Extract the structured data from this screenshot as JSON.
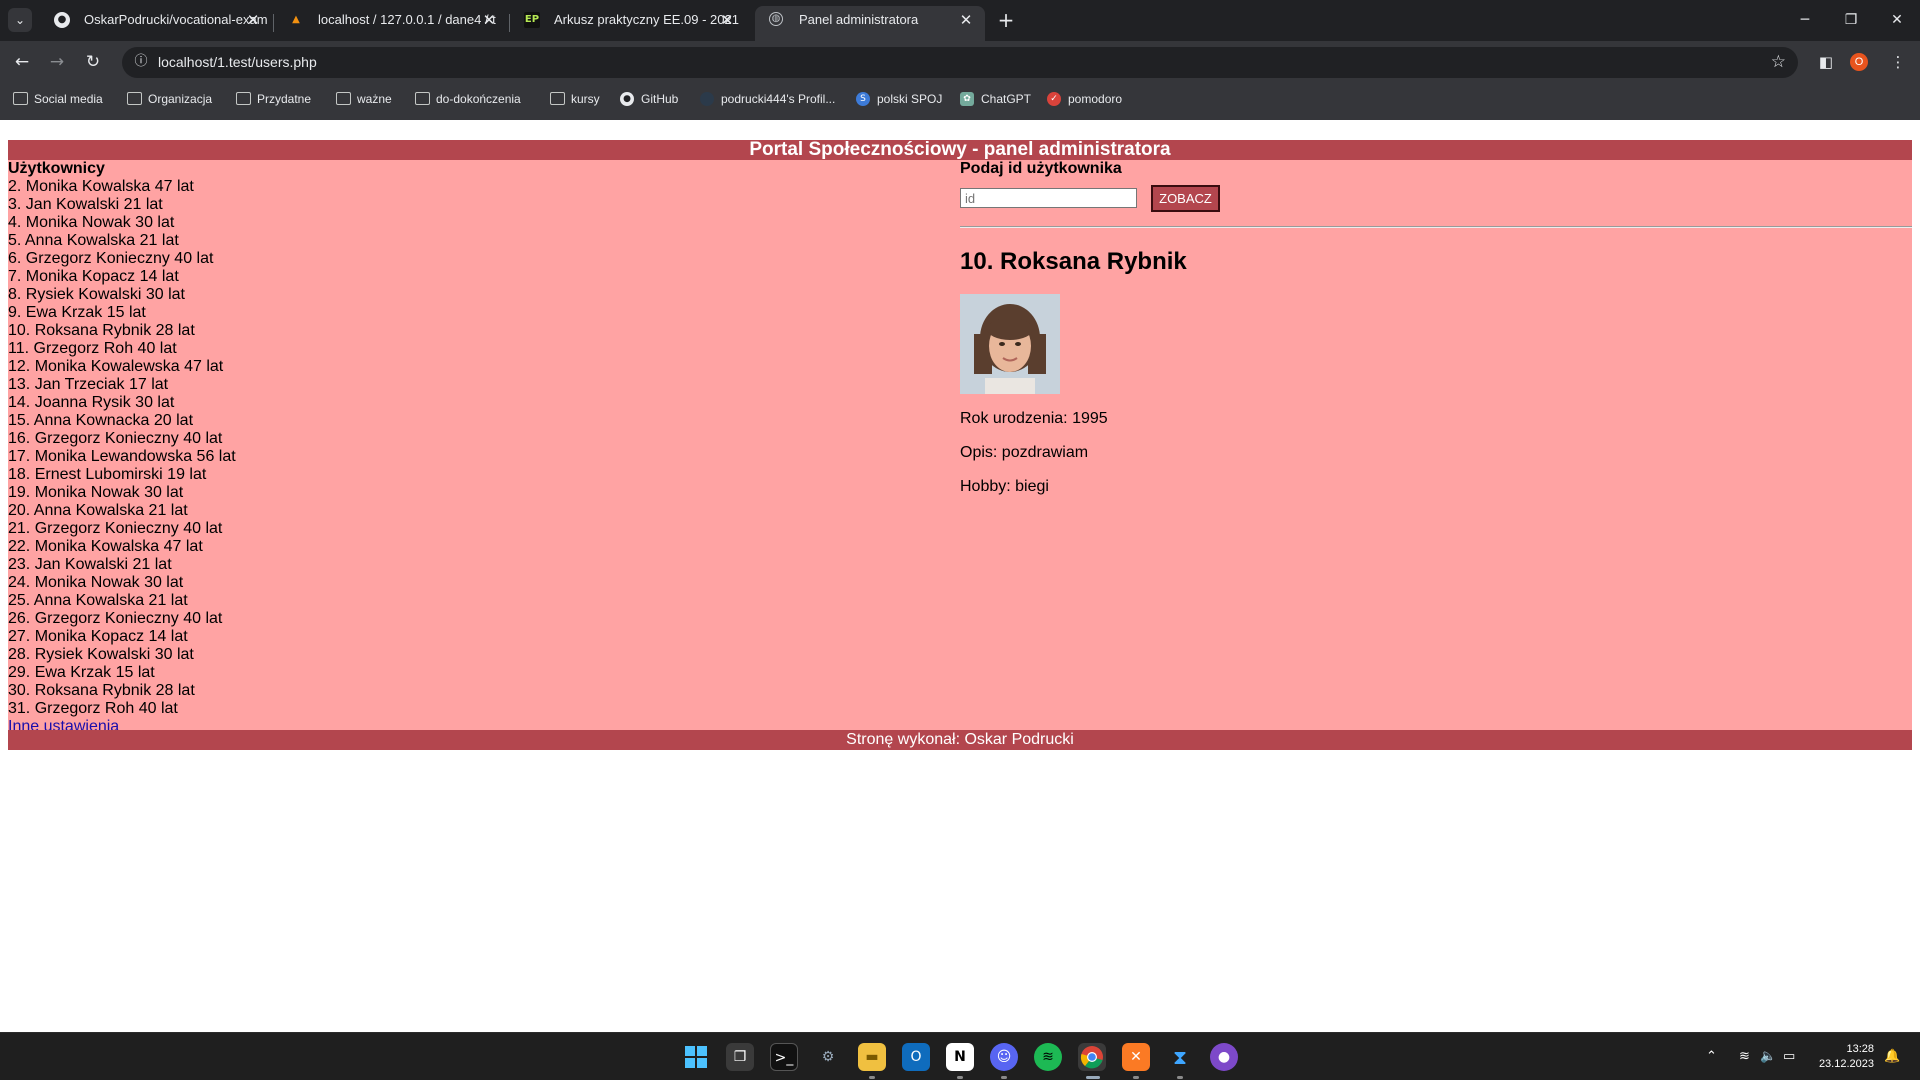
{
  "browser": {
    "tabs": [
      {
        "title": "OskarPodrucki/vocational-exam",
        "favicon": "github-icon",
        "active": false
      },
      {
        "title": "localhost / 127.0.0.1 / dane4 / t",
        "favicon": "phpmyadmin-icon",
        "active": false
      },
      {
        "title": "Arkusz praktyczny EE.09 - 2021",
        "favicon": "ep-icon",
        "active": false
      },
      {
        "title": "Panel administratora",
        "favicon": "globe-icon",
        "active": true
      }
    ],
    "url": "localhost/1.test/users.php",
    "profile_badge": "O",
    "bookmarks": [
      {
        "label": "Social media",
        "icon": "folder-icon"
      },
      {
        "label": "Organizacja",
        "icon": "folder-icon"
      },
      {
        "label": "Przydatne",
        "icon": "folder-icon"
      },
      {
        "label": "ważne",
        "icon": "folder-icon"
      },
      {
        "label": "do-dokończenia",
        "icon": "folder-icon"
      },
      {
        "label": "kursy",
        "icon": "folder-icon"
      },
      {
        "label": "GitHub",
        "icon": "github-icon"
      },
      {
        "label": "podrucki444's Profil...",
        "icon": "profile-icon"
      },
      {
        "label": "polski SPOJ",
        "icon": "spoj-icon"
      },
      {
        "label": "ChatGPT",
        "icon": "chatgpt-icon"
      },
      {
        "label": "pomodoro",
        "icon": "pomodoro-icon"
      }
    ]
  },
  "page": {
    "banner": "Portal Społecznościowy - panel administratora",
    "users_heading": "Użytkownicy",
    "users": [
      "2. Monika Kowalska 47 lat",
      "3. Jan Kowalski 21 lat",
      "4. Monika Nowak 30 lat",
      "5. Anna Kowalska 21 lat",
      "6. Grzegorz Konieczny 40 lat",
      "7. Monika Kopacz 14 lat",
      "8. Rysiek Kowalski 30 lat",
      "9. Ewa Krzak 15 lat",
      "10. Roksana Rybnik 28 lat",
      "11. Grzegorz Roh 40 lat",
      "12. Monika Kowalewska 47 lat",
      "13. Jan Trzeciak 17 lat",
      "14. Joanna Rysik 30 lat",
      "15. Anna Kownacka 20 lat",
      "16. Grzegorz Konieczny 40 lat",
      "17. Monika Lewandowska 56 lat",
      "18. Ernest Lubomirski 19 lat",
      "19. Monika Nowak 30 lat",
      "20. Anna Kowalska 21 lat",
      "21. Grzegorz Konieczny 40 lat",
      "22. Monika Kowalska 47 lat",
      "23. Jan Kowalski 21 lat",
      "24. Monika Nowak 30 lat",
      "25. Anna Kowalska 21 lat",
      "26. Grzegorz Konieczny 40 lat",
      "27. Monika Kopacz 14 lat",
      "28. Rysiek Kowalski 30 lat",
      "29. Ewa Krzak 15 lat",
      "30. Roksana Rybnik 28 lat",
      "31. Grzegorz Roh 40 lat"
    ],
    "other_settings_link": "Inne ustawienia",
    "form": {
      "label": "Podaj id użytkownika",
      "input_value": "",
      "input_placeholder": "id",
      "button": "ZOBACZ"
    },
    "profile": {
      "name": "10. Roksana Rybnik",
      "birth_year": "Rok urodzenia: 1995",
      "description": "Opis: pozdrawiam",
      "hobby": "Hobby: biegi"
    },
    "footer": "Stronę wykonał: Oskar Podrucki"
  },
  "taskbar": {
    "time": "13:28",
    "date": "23.12.2023",
    "apps": [
      "start-icon",
      "task-view-icon",
      "terminal-icon",
      "settings-icon",
      "file-explorer-icon",
      "outlook-icon",
      "notion-icon",
      "discord-icon",
      "spotify-icon",
      "chrome-icon",
      "xampp-icon",
      "vscode-icon",
      "github-desktop-icon"
    ]
  },
  "colors": {
    "banner": "#b3464e",
    "content_background": "#ffa3a3",
    "link": "#1a0dab"
  }
}
